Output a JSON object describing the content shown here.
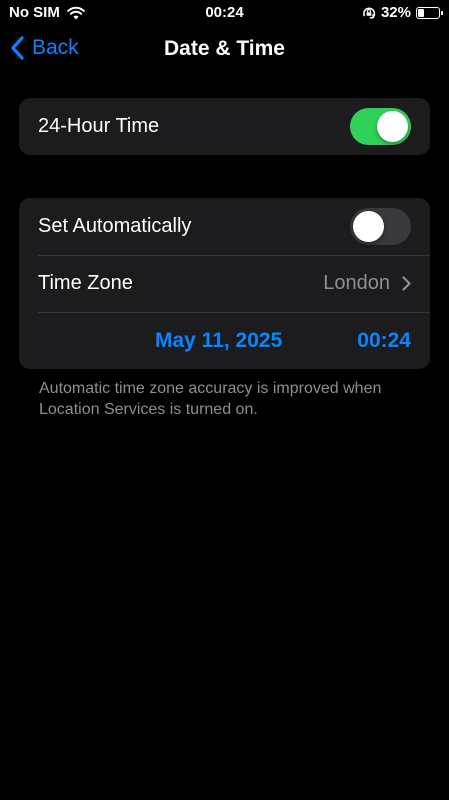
{
  "status_bar": {
    "carrier": "No SIM",
    "time": "00:24",
    "battery_percent": "32%",
    "battery_level": 0.32,
    "icons": [
      "wifi-icon",
      "orientation-lock-icon",
      "battery-icon"
    ]
  },
  "nav": {
    "back_label": "Back",
    "title": "Date & Time"
  },
  "group1": {
    "hour24_label": "24-Hour Time",
    "hour24_on": true
  },
  "group2": {
    "set_auto_label": "Set Automatically",
    "set_auto_on": false,
    "timezone_label": "Time Zone",
    "timezone_value": "London",
    "date_value": "May 11, 2025",
    "time_value": "00:24"
  },
  "footer": {
    "note": "Automatic time zone accuracy is improved when Location Services is turned on."
  },
  "colors": {
    "accent": "#0a84ff",
    "toggle_on": "#30d158",
    "toggle_off": "#39393d",
    "cell_bg": "#1c1c1e",
    "secondary_text": "#8e8e93"
  }
}
